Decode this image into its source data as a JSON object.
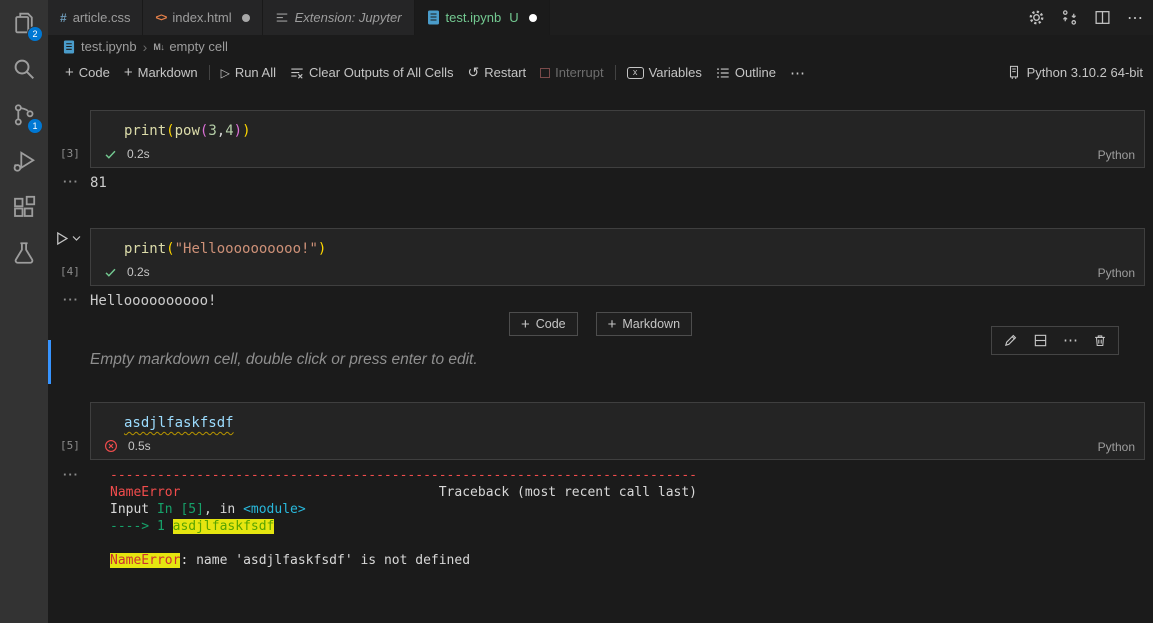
{
  "icons": {
    "add": "+",
    "run_all": "▷",
    "restart": "↺",
    "more": "⋯",
    "check": "✓",
    "collapse": "···",
    "crumb_sep": "›",
    "var_x": "x"
  },
  "activity_bar": {
    "explorer_badge": "2",
    "scm_badge": "1"
  },
  "tab_bar": {
    "tabs": [
      {
        "label": "article.css",
        "css_glyph": "#"
      },
      {
        "label": "index.html",
        "html_glyph": "<>"
      },
      {
        "label": "Extension: Jupyter"
      },
      {
        "label": "test.ipynb",
        "git_status": "U"
      }
    ]
  },
  "breadcrumb": {
    "file": "test.ipynb",
    "cell_glyph": "M↓",
    "cell": "empty cell"
  },
  "toolbar": {
    "add_code": "Code",
    "add_markdown": "Markdown",
    "run_all": "Run All",
    "clear_outputs": "Clear Outputs of All Cells",
    "restart": "Restart",
    "interrupt": "Interrupt",
    "variables": "Variables",
    "outline": "Outline",
    "kernel": "Python 3.10.2 64-bit"
  },
  "insert_bar": {
    "code": "Code",
    "markdown": "Markdown"
  },
  "markdown_cell": {
    "placeholder": "Empty markdown cell, double click or press enter to edit."
  },
  "cells": {
    "c3": {
      "exec_label": "[3]",
      "duration": "0.2s",
      "lang": "Python",
      "tokens": [
        {
          "t": "print",
          "c": "fn"
        },
        {
          "t": "(",
          "c": "b1"
        },
        {
          "t": "pow",
          "c": "fn"
        },
        {
          "t": "(",
          "c": "b2"
        },
        {
          "t": "3",
          "c": "num"
        },
        {
          "t": ",",
          "c": "pun"
        },
        {
          "t": "4",
          "c": "num"
        },
        {
          "t": ")",
          "c": "b2"
        },
        {
          "t": ")",
          "c": "b1"
        }
      ],
      "output": "81"
    },
    "c4": {
      "exec_label": "[4]",
      "duration": "0.2s",
      "lang": "Python",
      "tokens": [
        {
          "t": "print",
          "c": "fn"
        },
        {
          "t": "(",
          "c": "b1"
        },
        {
          "t": "\"Helloooooooooo!\"",
          "c": "str"
        },
        {
          "t": ")",
          "c": "b1"
        }
      ],
      "output": "Helloooooooooo!"
    },
    "c5": {
      "exec_label": "[5]",
      "duration": "0.5s",
      "lang": "Python",
      "tokens": [
        {
          "t": "asdjlfaskfsdf",
          "c": "var"
        }
      ],
      "traceback_lines": [
        {
          "tokens": [
            {
              "t": "---------------------------------------------------------------------------",
              "c": "red"
            }
          ]
        },
        {
          "tokens": [
            {
              "t": "NameError",
              "c": "red"
            },
            {
              "t": "                                 Traceback (most recent call last)",
              "c": "wht"
            }
          ]
        },
        {
          "tokens": [
            {
              "t": "Input ",
              "c": "wht"
            },
            {
              "t": "In [5]",
              "c": "grn"
            },
            {
              "t": ", in ",
              "c": "wht"
            },
            {
              "t": "<module>",
              "c": "cyn"
            }
          ]
        },
        {
          "tokens": [
            {
              "t": "----> 1 ",
              "c": "grn"
            },
            {
              "t": "asdjlfaskfsdf",
              "c": "hlg"
            }
          ]
        },
        {
          "tokens": []
        },
        {
          "tokens": [
            {
              "t": "NameError",
              "c": "hlr"
            },
            {
              "t": ": name 'asdjlfaskfsdf' is not defined",
              "c": "wht"
            }
          ]
        }
      ]
    }
  }
}
